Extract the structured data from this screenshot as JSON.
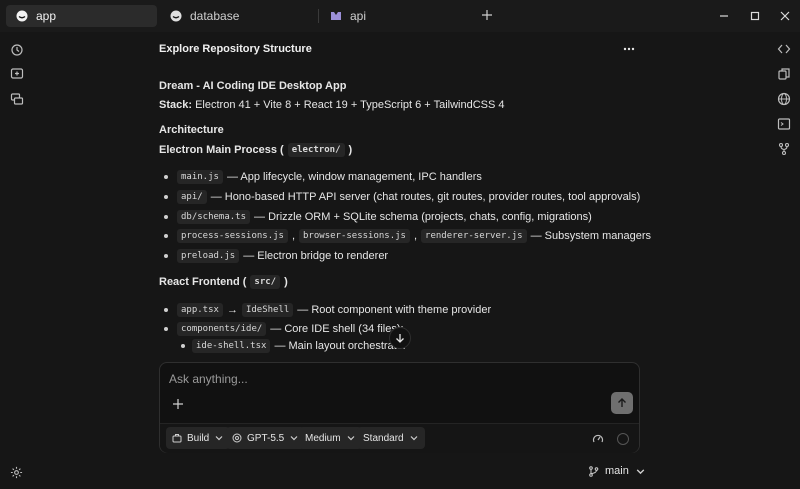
{
  "tabs": [
    {
      "label": "app",
      "icon": "chat-bubble-icon",
      "active": true
    },
    {
      "label": "database",
      "icon": "chat-bubble-icon",
      "active": false
    },
    {
      "label": "api",
      "icon": "provider-logo-icon",
      "active": false
    }
  ],
  "header": {
    "title": "Explore Repository Structure"
  },
  "doc": {
    "heading1": "Dream - AI Coding IDE Desktop App",
    "stack_label": "Stack:",
    "stack_value": "Electron 41 + Vite 8 + React 19 + TypeScript 6 + TailwindCSS 4",
    "arch": "Architecture",
    "main_process": {
      "title": "Electron Main Process (",
      "code": "electron/",
      "close": ")",
      "items": [
        {
          "code": "main.js",
          "text": "— App lifecycle, window management, IPC handlers"
        },
        {
          "code": "api/",
          "text": "— Hono-based HTTP API server (chat routes, git routes, provider routes, tool approvals)"
        },
        {
          "code": "db/schema.ts",
          "text": "— Drizzle ORM + SQLite schema (projects, chats, config, migrations)"
        },
        {
          "codes": [
            "process-sessions.js",
            "browser-sessions.js",
            "renderer-server.js"
          ],
          "sep": ",",
          "text": "— Subsystem managers"
        },
        {
          "code": "preload.js",
          "text": "— Electron bridge to renderer"
        }
      ]
    },
    "frontend": {
      "title": "React Frontend (",
      "code": "src/",
      "close": ")",
      "items": [
        {
          "code": "app.tsx",
          "arrow": "→",
          "code2": "IdeShell",
          "text": "— Root component with theme provider"
        },
        {
          "code": "components/ide/",
          "text": "— Core IDE shell (34 files):"
        }
      ],
      "subitems": [
        {
          "code": "ide-shell.tsx",
          "text": "— Main layout orchestrator"
        }
      ]
    }
  },
  "composer": {
    "placeholder": "Ask anything...",
    "chips": [
      {
        "label": "Build",
        "icon": "briefcase-icon"
      },
      {
        "label": "GPT-5.5",
        "icon": "model-icon"
      },
      {
        "label": "Medium"
      },
      {
        "label": "Standard"
      }
    ]
  },
  "footer": {
    "branch": "main"
  }
}
